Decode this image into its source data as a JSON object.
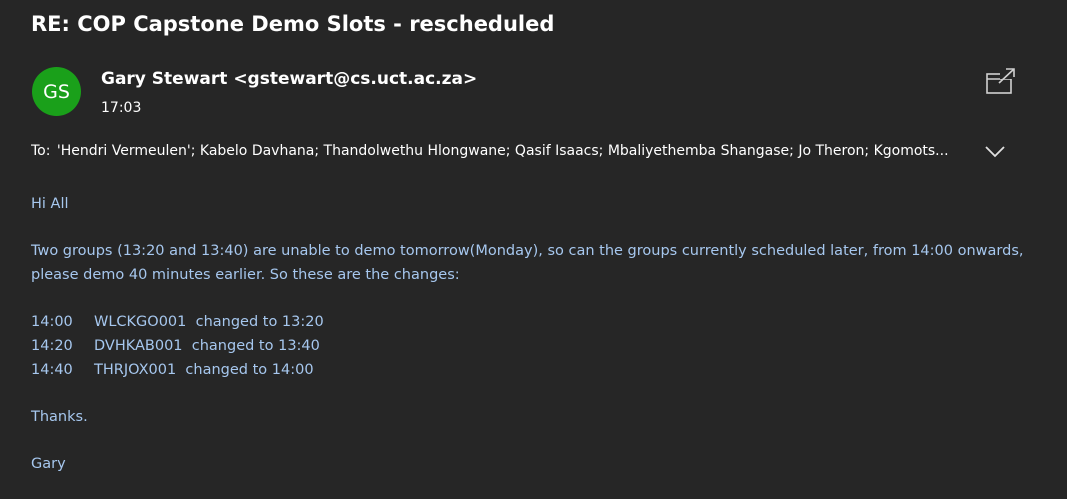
{
  "email": {
    "subject": "RE: COP Capstone Demo Slots - rescheduled",
    "avatar_initials": "GS",
    "avatar_color": "#1aa01a",
    "sender": "Gary Stewart <gstewart@cs.uct.ac.za>",
    "time": "17:03",
    "to_label": "To:",
    "to_recipients": "'Hendri Vermeulen'; Kabelo Davhana; Thandolwethu Hlongwane; Qasif Isaacs; Mbaliyethemba Shangase; Jo Theron; Kgomots...",
    "greeting": "Hi All",
    "paragraph1": "Two groups (13:20 and 13:40) are unable to demo tomorrow(Monday), so can the groups currently scheduled later, from 14:00 onwards, please demo 40 minutes earlier. So these are the changes:",
    "changes": [
      {
        "time": "14:00",
        "text": "WLCKGO001  changed to 13:20"
      },
      {
        "time": "14:20",
        "text": "DVHKAB001  changed to 13:40"
      },
      {
        "time": "14:40",
        "text": "THRJOX001  changed to 14:00"
      }
    ],
    "thanks": "Thanks.",
    "signature": "Gary"
  },
  "icons": {
    "popout": "popout-icon",
    "expand": "chevron-down-icon"
  },
  "colors": {
    "background": "#262626",
    "body_text": "#a6c7ee"
  }
}
